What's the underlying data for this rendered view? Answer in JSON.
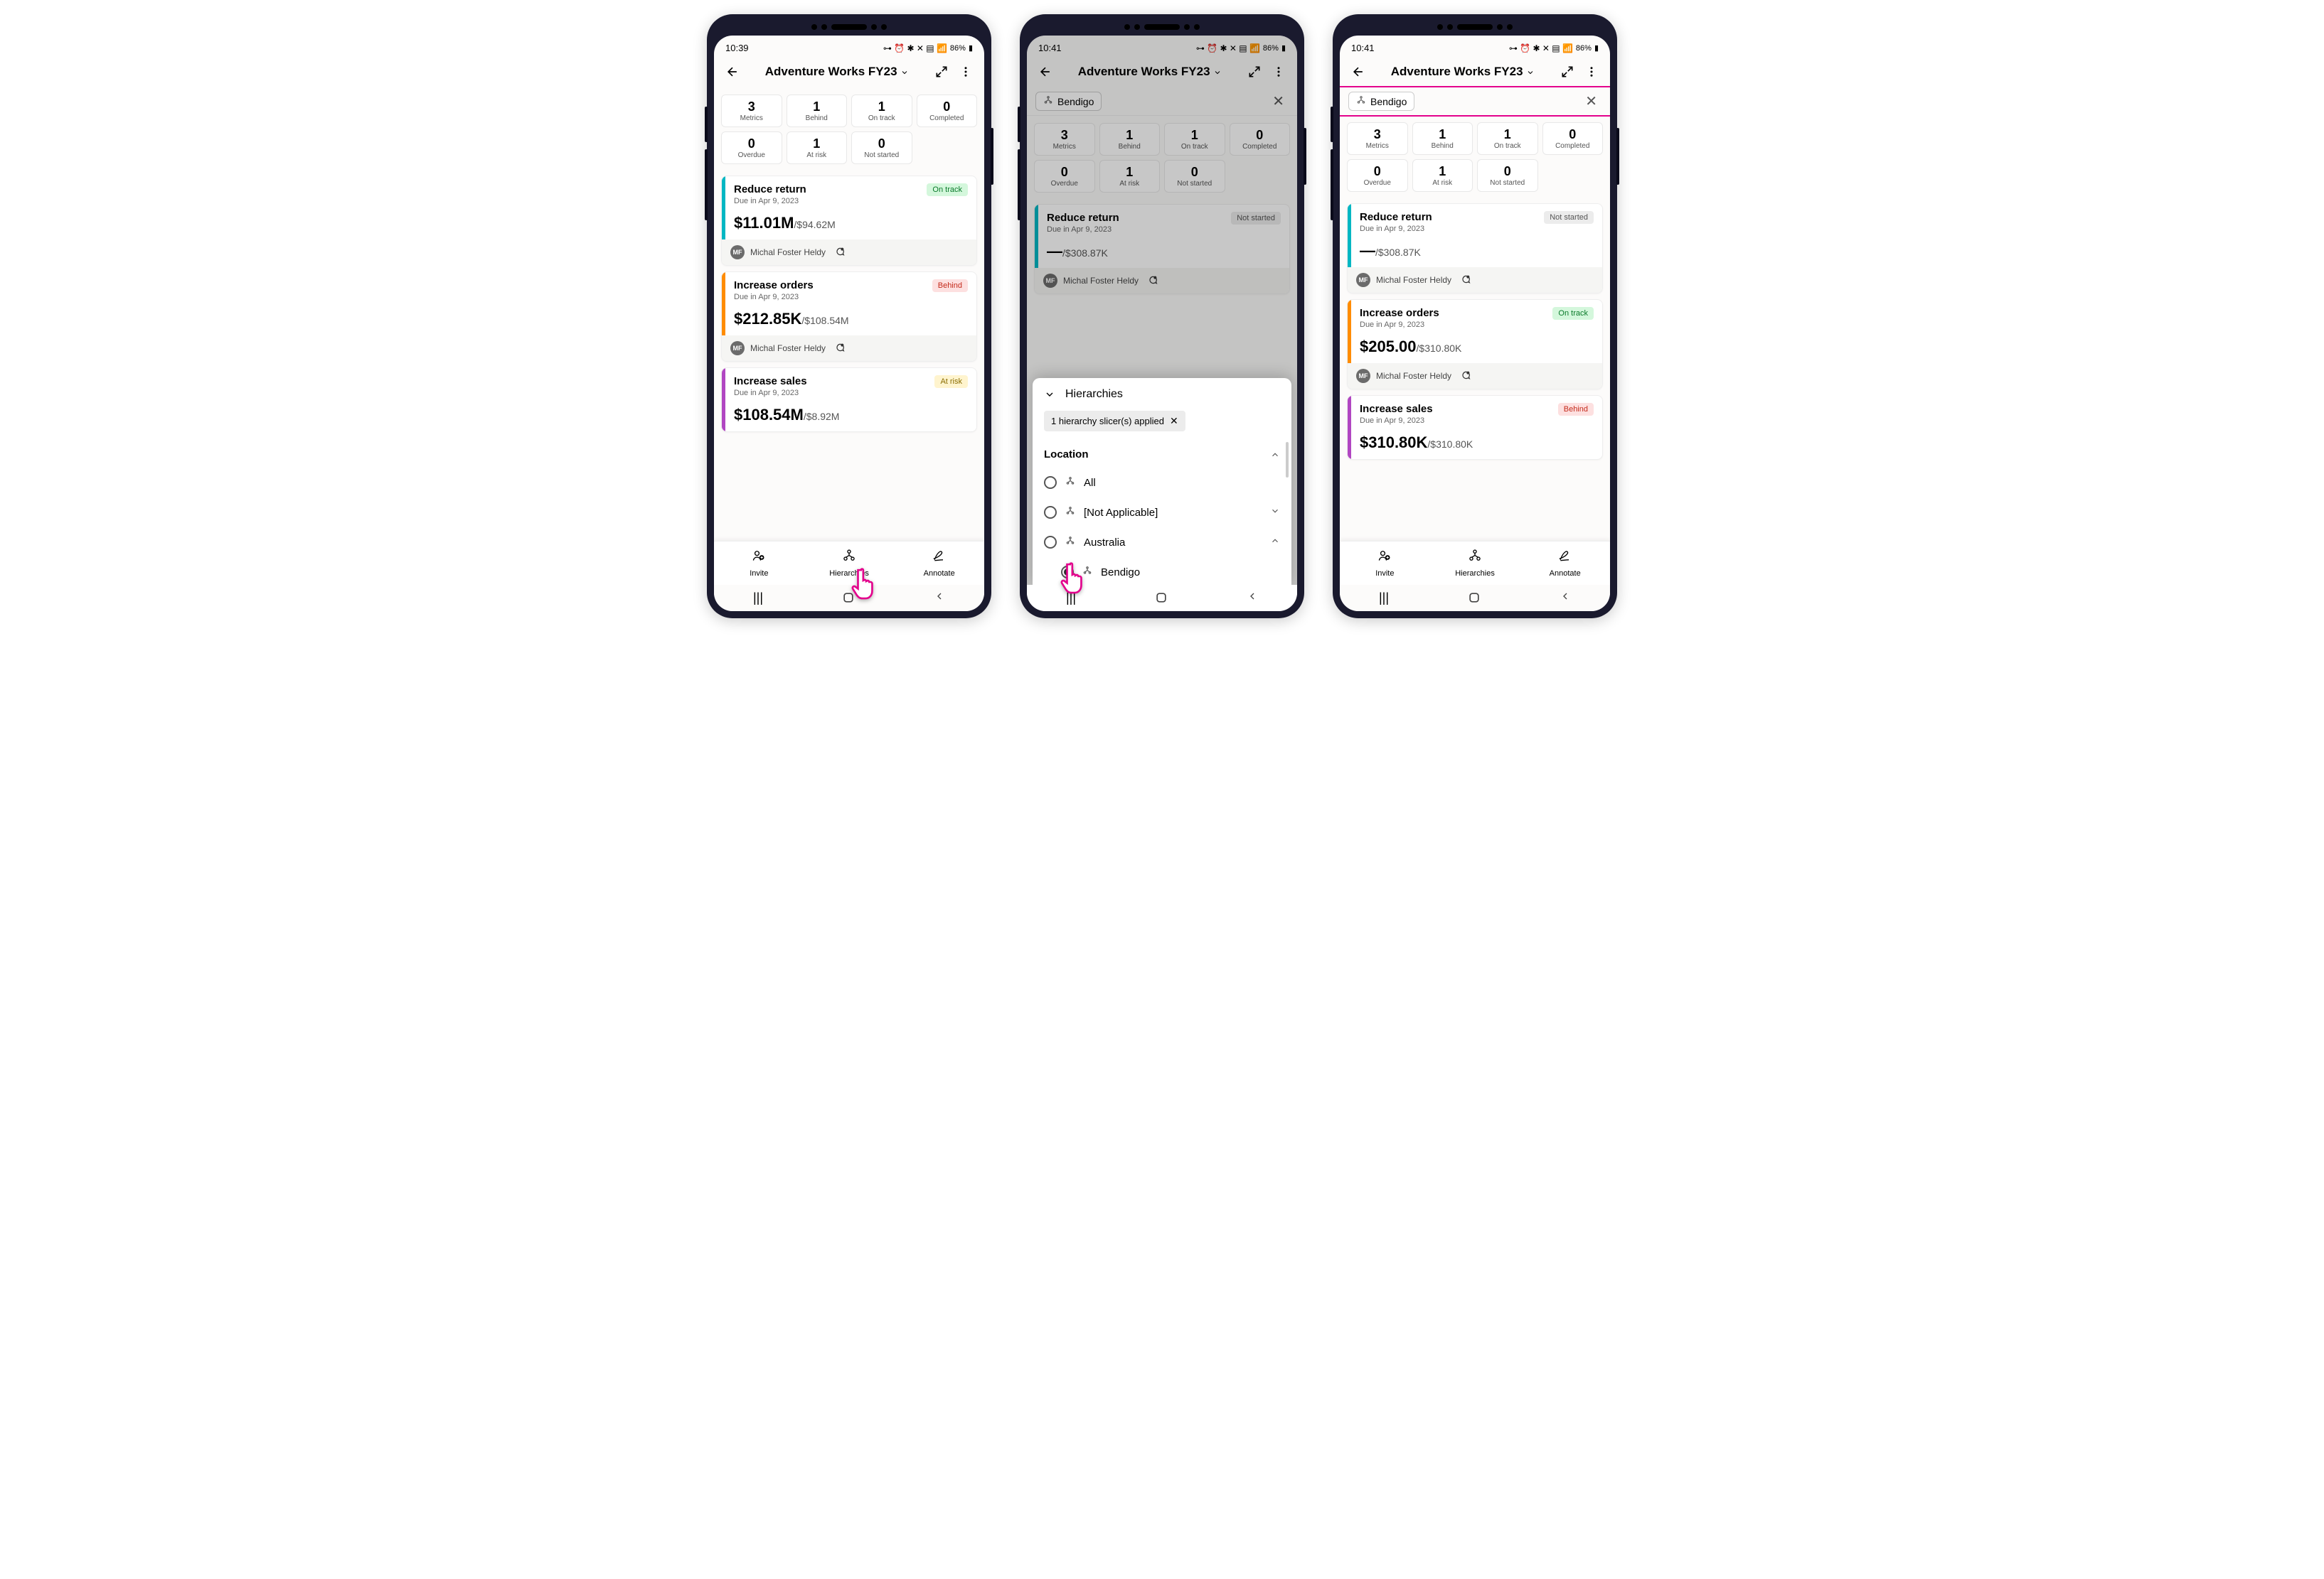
{
  "common": {
    "app_title": "Adventure Works FY23",
    "avatar_initials": "MF",
    "owner_name": "Michal Foster Heldy",
    "actions": {
      "invite": "Invite",
      "hierarchies": "Hierarchies",
      "annotate": "Annotate"
    },
    "status_pct": "86%"
  },
  "phone1": {
    "time": "10:39",
    "stats": [
      {
        "n": "3",
        "l": "Metrics"
      },
      {
        "n": "1",
        "l": "Behind"
      },
      {
        "n": "1",
        "l": "On track"
      },
      {
        "n": "0",
        "l": "Completed"
      },
      {
        "n": "0",
        "l": "Overdue"
      },
      {
        "n": "1",
        "l": "At risk"
      },
      {
        "n": "0",
        "l": "Not started"
      }
    ],
    "metrics": [
      {
        "title": "Reduce return",
        "due": "Due in Apr 9, 2023",
        "val": "$11.01M",
        "target": "/$94.62M",
        "badge": "On track",
        "badgeClass": "ontrack",
        "color": "teal"
      },
      {
        "title": "Increase orders",
        "due": "Due in Apr 9, 2023",
        "val": "$212.85K",
        "target": "/$108.54M",
        "badge": "Behind",
        "badgeClass": "behind",
        "color": "orange"
      },
      {
        "title": "Increase sales",
        "due": "Due in Apr 9, 2023",
        "val": "$108.54M",
        "target": "/$8.92M",
        "badge": "At risk",
        "badgeClass": "atrisk",
        "color": "purple"
      }
    ]
  },
  "phone2": {
    "time": "10:41",
    "chip_label": "Bendigo",
    "stats": [
      {
        "n": "3",
        "l": "Metrics"
      },
      {
        "n": "1",
        "l": "Behind"
      },
      {
        "n": "1",
        "l": "On track"
      },
      {
        "n": "0",
        "l": "Completed"
      },
      {
        "n": "0",
        "l": "Overdue"
      },
      {
        "n": "1",
        "l": "At risk"
      },
      {
        "n": "0",
        "l": "Not started"
      }
    ],
    "metric": {
      "title": "Reduce return",
      "due": "Due in Apr 9, 2023",
      "val": "—",
      "target": "/$308.87K",
      "badge": "Not started",
      "badgeClass": "notstarted",
      "color": "teal"
    },
    "sheet": {
      "title": "Hierarchies",
      "applied": "1 hierarchy slicer(s) applied",
      "section": "Location",
      "options": [
        {
          "label": "All",
          "checked": false,
          "expand": null
        },
        {
          "label": "[Not Applicable]",
          "checked": false,
          "expand": "down"
        },
        {
          "label": "Australia",
          "checked": false,
          "expand": "up"
        },
        {
          "label": "Bendigo",
          "checked": true,
          "indent": true
        }
      ]
    }
  },
  "phone3": {
    "time": "10:41",
    "chip_label": "Bendigo",
    "stats": [
      {
        "n": "3",
        "l": "Metrics"
      },
      {
        "n": "1",
        "l": "Behind"
      },
      {
        "n": "1",
        "l": "On track"
      },
      {
        "n": "0",
        "l": "Completed"
      },
      {
        "n": "0",
        "l": "Overdue"
      },
      {
        "n": "1",
        "l": "At risk"
      },
      {
        "n": "0",
        "l": "Not started"
      }
    ],
    "metrics": [
      {
        "title": "Reduce return",
        "due": "Due in Apr 9, 2023",
        "val": "—",
        "target": "/$308.87K",
        "badge": "Not started",
        "badgeClass": "notstarted",
        "color": "teal"
      },
      {
        "title": "Increase orders",
        "due": "Due in Apr 9, 2023",
        "val": "$205.00",
        "target": "/$310.80K",
        "badge": "On track",
        "badgeClass": "ontrack",
        "color": "orange"
      },
      {
        "title": "Increase sales",
        "due": "Due in Apr 9, 2023",
        "val": "$310.80K",
        "target": "/$310.80K",
        "badge": "Behind",
        "badgeClass": "behind",
        "color": "purple"
      }
    ]
  }
}
